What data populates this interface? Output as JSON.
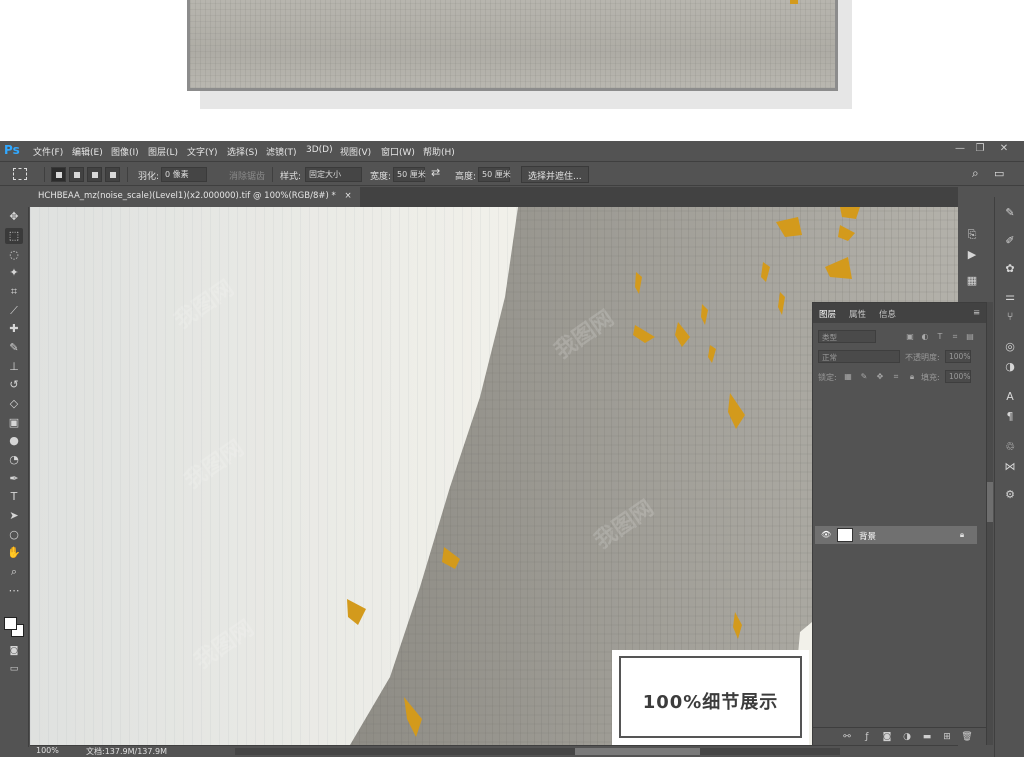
{
  "app": {
    "logo": "Ps"
  },
  "menu": [
    "文件(F)",
    "编辑(E)",
    "图像(I)",
    "图层(L)",
    "文字(Y)",
    "选择(S)",
    "滤镜(T)",
    "3D(D)",
    "视图(V)",
    "窗口(W)",
    "帮助(H)"
  ],
  "window_controls": [
    "—",
    "❐",
    "✕"
  ],
  "options": {
    "feather_label": "羽化:",
    "feather_value": "0 像素",
    "antialias_label": "消除锯齿",
    "style_label": "样式:",
    "style_value": "固定大小",
    "width_label": "宽度:",
    "width_value": "50 厘米",
    "height_label": "高度:",
    "height_value": "50 厘米",
    "select_mask_button": "选择并遮住..."
  },
  "document": {
    "tab_title": "HCHBEAA_mz(noise_scale)(Level1)(x2.000000).tif @ 100%(RGB/8#) *",
    "close": "×"
  },
  "status": {
    "zoom": "100%",
    "doc_info": "文档:137.9M/137.9M"
  },
  "layers_panel": {
    "tabs": [
      "图层",
      "属性",
      "信息"
    ],
    "kind_filter": "类型",
    "blend_mode": "正常",
    "opacity_label": "不透明度:",
    "opacity_value": "100%",
    "lock_label": "锁定:",
    "fill_label": "填充:",
    "fill_value": "100%",
    "layer_name": "背景"
  },
  "badge": {
    "text": "100%细节展示"
  },
  "watermark": "我图网",
  "colors": {
    "ui_bg": "#535353",
    "ps_blue": "#31a8ff",
    "gold": "#d39a1c",
    "canvas_light": "#f3f2ea",
    "canvas_gray": "#9c9a93"
  }
}
